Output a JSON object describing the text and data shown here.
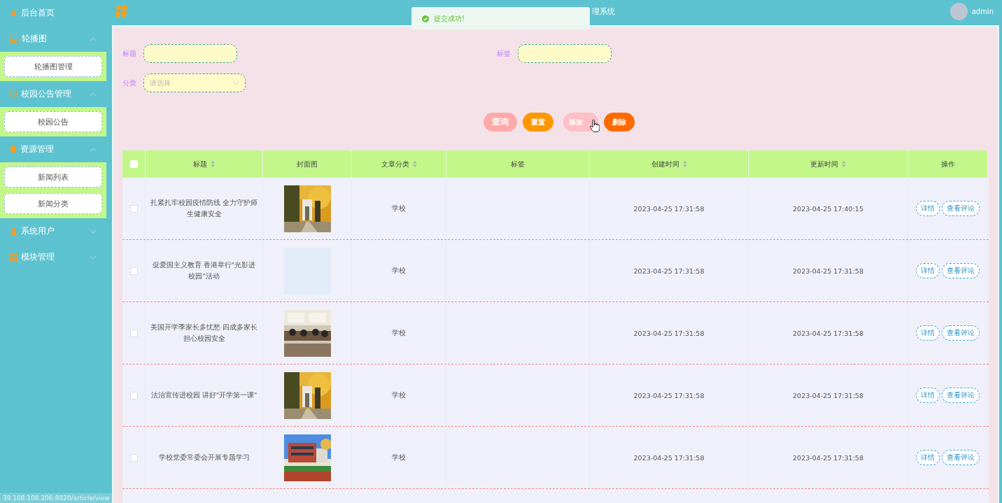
{
  "header": {
    "title": "理系统",
    "user": "admin"
  },
  "toast": {
    "message": "提交成功!"
  },
  "sidebar": {
    "items": [
      {
        "label": "后台首页"
      },
      {
        "label": "轮播图",
        "expanded": true,
        "children": [
          {
            "label": "轮播图管理"
          }
        ]
      },
      {
        "label": "校园公告管理",
        "expanded": true,
        "children": [
          {
            "label": "校园公告"
          }
        ]
      },
      {
        "label": "资源管理",
        "expanded": true,
        "children": [
          {
            "label": "新闻列表"
          },
          {
            "label": "新闻分类"
          }
        ]
      },
      {
        "label": "系统用户",
        "expanded": false
      },
      {
        "label": "模块管理",
        "expanded": false
      }
    ]
  },
  "filters": [
    {
      "label": "标题",
      "kind": "input"
    },
    {
      "label": "标签",
      "kind": "input"
    },
    {
      "label": "分类",
      "kind": "select",
      "placeholder": "请选择"
    }
  ],
  "buttons": [
    {
      "label": "查询",
      "kind": "query"
    },
    {
      "label": "重置",
      "kind": "reset"
    },
    {
      "label": "添加",
      "kind": "add"
    },
    {
      "label": "删除",
      "kind": "delete"
    }
  ],
  "table": {
    "select_all_checked": false,
    "columns": [
      {
        "label": "标题",
        "sortable": true
      },
      {
        "label": "封面图",
        "sortable": false
      },
      {
        "label": "文章分类",
        "sortable": true
      },
      {
        "label": "标签",
        "sortable": false
      },
      {
        "label": "创建时间",
        "sortable": true
      },
      {
        "label": "更新时间",
        "sortable": true
      },
      {
        "label": "操作",
        "sortable": false
      }
    ],
    "rows": [
      {
        "checked": false,
        "title": "扎紧扎牢校园疫情防线 全力守护师生健康安全",
        "cover": {
          "kind": "picture"
        },
        "category": "学校",
        "created": "2023-04-25 17:31:58",
        "updated": "2023-04-25 17:40:15",
        "actions": [
          "详情",
          "查看评论"
        ]
      },
      {
        "checked": false,
        "title": "促爱国主义教育 香港举行\"光影进校园\"活动",
        "category": "学校",
        "created": "2023-04-25 17:31:58",
        "updated": "2023-04-25 17:31:58",
        "actions": [
          "详情",
          "查看评论"
        ]
      },
      {
        "checked": false,
        "title": "美国开学季家长多忧愁 四成多家长担心校园安全",
        "cover": {
          "kind": "picture"
        },
        "category": "学校",
        "created": "2023-04-25 17:31:58",
        "updated": "2023-04-25 17:31:58",
        "actions": [
          "详情",
          "查看评论"
        ]
      },
      {
        "checked": false,
        "title": "法治宣传进校园 讲好\"开学第一课\"",
        "cover": {
          "kind": "picture"
        },
        "category": "学校",
        "created": "2023-04-25 17:31:58",
        "updated": "2023-04-25 17:31:58",
        "actions": [
          "详情",
          "查看评论"
        ]
      },
      {
        "checked": false,
        "title": "学校党委常委会开展专题学习",
        "cover": {
          "kind": "picture"
        },
        "category": "学校",
        "created": "2023-04-25 17:31:58",
        "updated": "2023-04-25 17:31:58",
        "actions": [
          "详情",
          "查看评论"
        ]
      }
    ]
  },
  "status_bar": {
    "url": "39.108.108.206:8020/article/view"
  }
}
